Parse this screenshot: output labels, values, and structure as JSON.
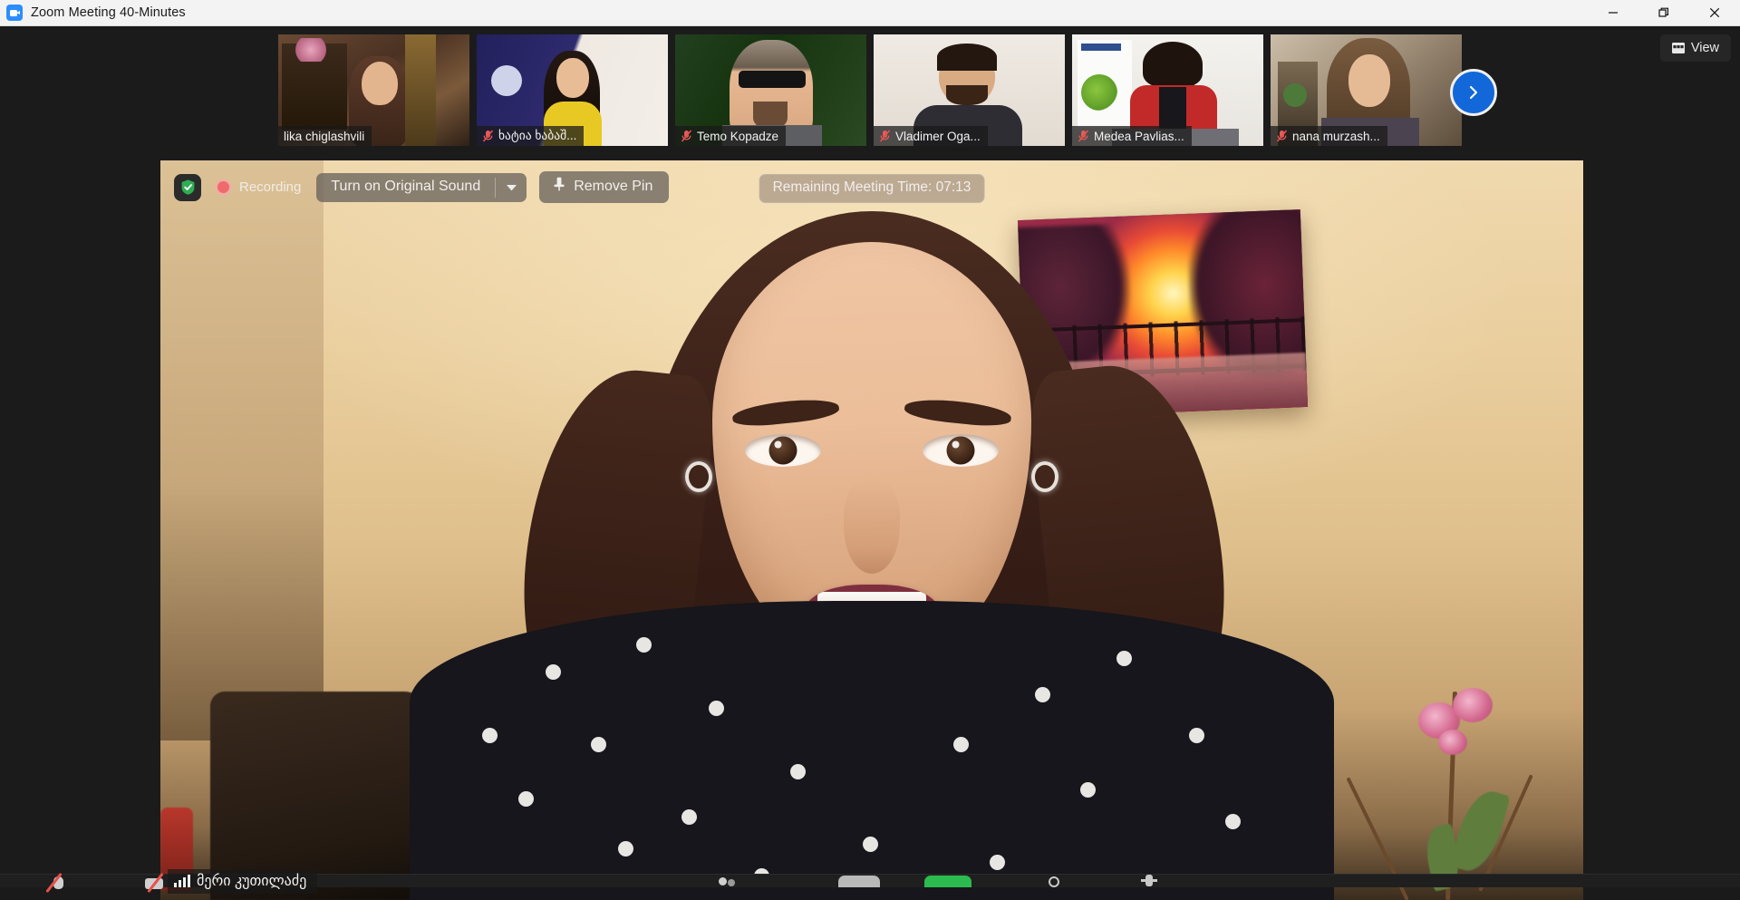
{
  "window": {
    "title": "Zoom Meeting 40-Minutes",
    "app_icon": "zoom-camera-icon",
    "controls": {
      "minimize": "minimize-icon",
      "maximize": "restore-icon",
      "close": "close-icon"
    }
  },
  "strip": {
    "next_page_button": "chevron-right-icon",
    "view_button": {
      "label": "View",
      "icon": "grid-view-icon"
    },
    "participants": [
      {
        "name": "lika chiglashvili",
        "muted": false
      },
      {
        "name": "ხატია ხაბაშ...",
        "muted": true
      },
      {
        "name": "Temo Kopadze",
        "muted": true
      },
      {
        "name": "Vladimer Oga...",
        "muted": true
      },
      {
        "name": "Medea Pavlias...",
        "muted": true
      },
      {
        "name": "nana murzash...",
        "muted": true
      }
    ]
  },
  "video_toolbar": {
    "security_icon": "shield-check-icon",
    "recording_label": "Recording",
    "recording_icon": "record-dot-icon",
    "original_sound_label": "Turn on Original Sound",
    "original_sound_caret": "chevron-down-icon",
    "remove_pin_label": "Remove Pin",
    "pin_icon": "pin-icon",
    "remaining_time_label": "Remaining Meeting Time: 07:13"
  },
  "active_speaker": {
    "name": "მერი კუთილაძე",
    "signal_icon": "signal-bars-icon"
  },
  "bottom_toolbar": {
    "items": [
      {
        "name": "mute-button",
        "icon": "microphone-muted-icon"
      },
      {
        "name": "stop-video-button",
        "icon": "camera-muted-icon"
      },
      {
        "name": "participants-button",
        "icon": "participants-icon"
      },
      {
        "name": "chat-button",
        "icon": "chat-icon"
      },
      {
        "name": "share-screen-button",
        "icon": "share-screen-icon"
      },
      {
        "name": "record-button",
        "icon": "record-icon"
      },
      {
        "name": "reactions-button",
        "icon": "reactions-icon"
      }
    ]
  },
  "colors": {
    "accent_blue": "#1268d8",
    "recording_red": "#ef6b6b",
    "muted_red": "#e8504a",
    "share_green": "#2bbb4e",
    "titlebar_bg": "#f3f3f3",
    "app_bg": "#1b1b1b"
  }
}
